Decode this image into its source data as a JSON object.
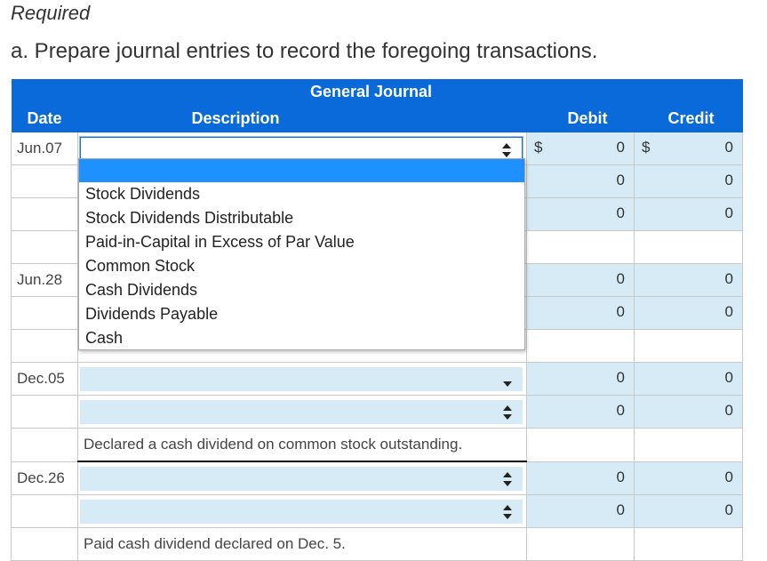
{
  "heading": {
    "required": "Required",
    "instruction": "a. Prepare journal entries to record the foregoing transactions."
  },
  "journal": {
    "title": "General Journal",
    "columns": {
      "date": "Date",
      "description": "Description",
      "debit": "Debit",
      "credit": "Credit"
    },
    "currency_symbol": "$",
    "rows": [
      {
        "date": "Jun.07",
        "debit": "0",
        "credit": "0"
      },
      {
        "date": "",
        "debit": "0",
        "credit": "0"
      },
      {
        "date": "",
        "debit": "0",
        "credit": "0"
      },
      {
        "date": "",
        "debit": "",
        "credit": ""
      },
      {
        "date": "Jun.28",
        "debit": "0",
        "credit": "0"
      },
      {
        "date": "",
        "debit": "0",
        "credit": "0"
      },
      {
        "date": "",
        "debit": "",
        "credit": ""
      },
      {
        "date": "Dec.05",
        "debit": "0",
        "credit": "0"
      },
      {
        "date": "",
        "debit": "0",
        "credit": "0"
      },
      {
        "date": "",
        "narration": "Declared a cash dividend on common stock outstanding.",
        "debit": "",
        "credit": ""
      },
      {
        "date": "Dec.26",
        "debit": "0",
        "credit": "0"
      },
      {
        "date": "",
        "debit": "0",
        "credit": "0"
      },
      {
        "date": "",
        "narration": "Paid cash dividend declared on Dec. 5.",
        "debit": "",
        "credit": ""
      }
    ]
  },
  "dropdown": {
    "options": [
      "Stock Dividends",
      "Stock Dividends Distributable",
      "Paid-in-Capital in Excess of Par Value",
      "Common Stock",
      "Cash Dividends",
      "Dividends Payable",
      "Cash"
    ]
  }
}
